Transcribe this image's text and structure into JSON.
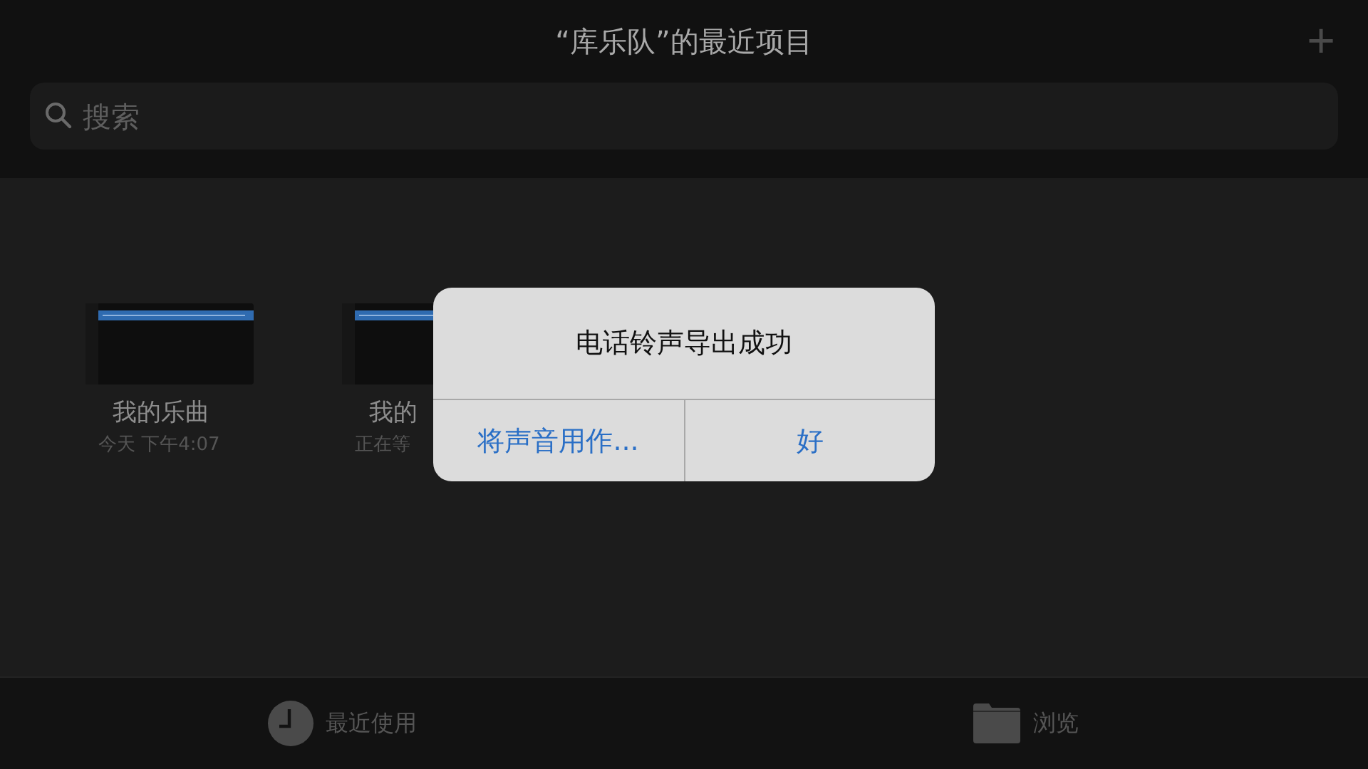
{
  "header": {
    "title": "“库乐队”的最近项目",
    "add_icon": "+"
  },
  "search": {
    "placeholder": "搜索"
  },
  "projects": [
    {
      "name": "我的乐曲",
      "subtitle": "今天 下午4:07"
    },
    {
      "name": "我的",
      "subtitle": "正在等"
    }
  ],
  "alert": {
    "title": "电话铃声导出成功",
    "buttons": [
      "将声音用作...",
      "好"
    ]
  },
  "tab_bar": [
    {
      "kind": "clock",
      "label": "最近使用"
    },
    {
      "kind": "folder",
      "label": "浏览"
    }
  ]
}
